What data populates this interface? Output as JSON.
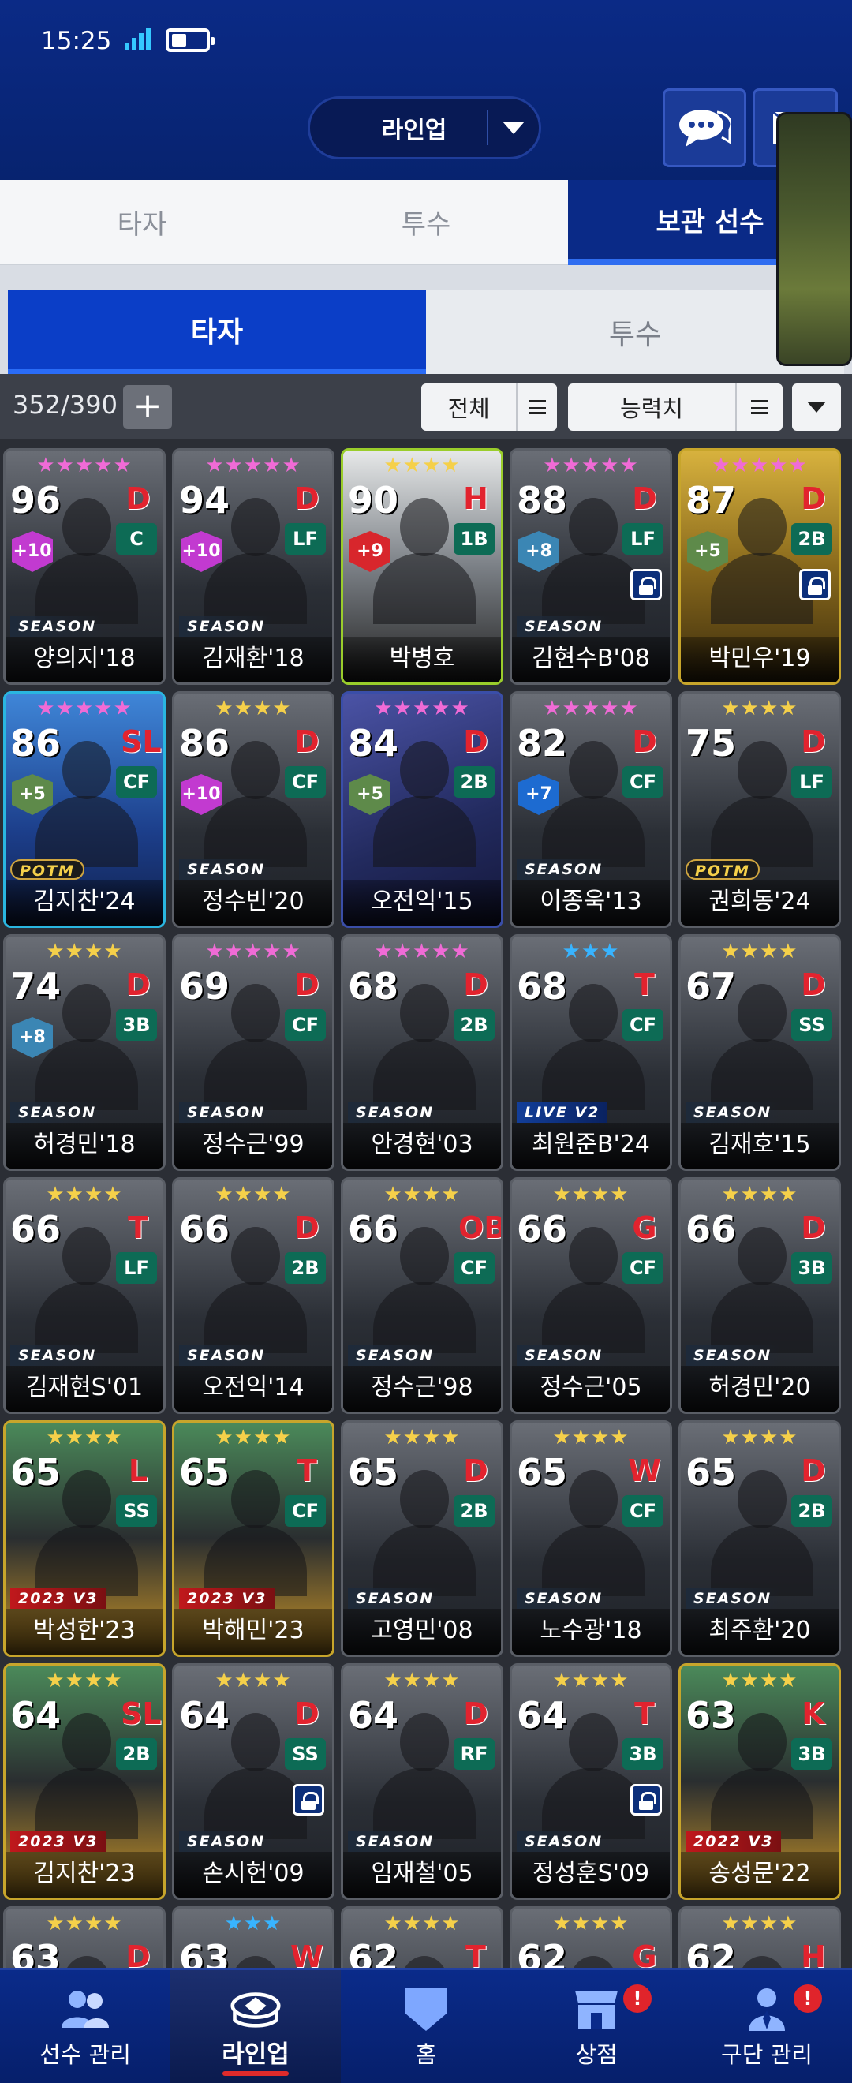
{
  "status_bar": {
    "time": "15:25"
  },
  "header": {
    "lineup_select": "라인업"
  },
  "main_tabs": [
    {
      "label": "타자",
      "active": false
    },
    {
      "label": "투수",
      "active": false
    },
    {
      "label": "보관 선수",
      "active": true
    }
  ],
  "sub_tabs": [
    {
      "label": "타자",
      "active": true
    },
    {
      "label": "투수",
      "active": false
    }
  ],
  "toolbar": {
    "count": "352/390",
    "add_label": "+",
    "filter_label": "전체",
    "sort_label": "능력치"
  },
  "cards": [
    {
      "ovr": "96",
      "stars": "★★★★★",
      "star_color": "pink",
      "team": "D",
      "pos": "C",
      "plus": "+10",
      "type": "SEASON",
      "name": "양의지'18",
      "locked": false,
      "style": ""
    },
    {
      "ovr": "94",
      "stars": "★★★★★",
      "star_color": "pink",
      "team": "D",
      "pos": "LF",
      "plus": "+10",
      "type": "SEASON",
      "name": "김재환'18",
      "locked": false,
      "style": ""
    },
    {
      "ovr": "90",
      "stars": "★★★★",
      "star_color": "gold",
      "team": "H",
      "pos": "1B",
      "plus": "+9",
      "type": "",
      "name": "박병호",
      "locked": false,
      "style": "lime"
    },
    {
      "ovr": "88",
      "stars": "★★★★★",
      "star_color": "pink",
      "team": "D",
      "pos": "LF",
      "plus": "+8",
      "type": "SEASON",
      "name": "김현수B'08",
      "locked": true,
      "style": ""
    },
    {
      "ovr": "87",
      "stars": "★★★★★",
      "star_color": "pink",
      "team": "D",
      "pos": "2B",
      "plus": "+5",
      "type": "",
      "name": "박민우'19",
      "locked": true,
      "style": "gold"
    },
    {
      "ovr": "86",
      "stars": "★★★★★",
      "star_color": "pink",
      "team": "SL",
      "pos": "CF",
      "plus": "+5",
      "type": "POTM",
      "name": "김지찬'24",
      "locked": false,
      "style": "blue"
    },
    {
      "ovr": "86",
      "stars": "★★★★",
      "star_color": "gold",
      "team": "D",
      "pos": "CF",
      "plus": "+10",
      "type": "SEASON",
      "name": "정수빈'20",
      "locked": false,
      "style": ""
    },
    {
      "ovr": "84",
      "stars": "★★★★★",
      "star_color": "pink",
      "team": "D",
      "pos": "2B",
      "plus": "+5",
      "type": "",
      "name": "오전익'15",
      "locked": false,
      "style": "navy"
    },
    {
      "ovr": "82",
      "stars": "★★★★★",
      "star_color": "pink",
      "team": "D",
      "pos": "CF",
      "plus": "+7",
      "type": "SEASON",
      "name": "이종욱'13",
      "locked": false,
      "style": ""
    },
    {
      "ovr": "75",
      "stars": "★★★★",
      "star_color": "gold",
      "team": "D",
      "pos": "LF",
      "plus": "",
      "type": "POTM",
      "name": "권희동'24",
      "locked": false,
      "style": ""
    },
    {
      "ovr": "74",
      "stars": "★★★★",
      "star_color": "gold",
      "team": "D",
      "pos": "3B",
      "plus": "+8",
      "type": "SEASON",
      "name": "허경민'18",
      "locked": false,
      "style": ""
    },
    {
      "ovr": "69",
      "stars": "★★★★★",
      "star_color": "pink",
      "team": "D",
      "pos": "CF",
      "plus": "",
      "type": "SEASON",
      "name": "정수근'99",
      "locked": false,
      "style": ""
    },
    {
      "ovr": "68",
      "stars": "★★★★★",
      "star_color": "pink",
      "team": "D",
      "pos": "2B",
      "plus": "",
      "type": "SEASON",
      "name": "안경현'03",
      "locked": false,
      "style": ""
    },
    {
      "ovr": "68",
      "stars": "★★★",
      "star_color": "blue",
      "team": "T",
      "pos": "CF",
      "plus": "",
      "type": "LIVE V2",
      "name": "최원준B'24",
      "locked": false,
      "style": ""
    },
    {
      "ovr": "67",
      "stars": "★★★★",
      "star_color": "gold",
      "team": "D",
      "pos": "SS",
      "plus": "",
      "type": "SEASON",
      "name": "김재호'15",
      "locked": false,
      "style": ""
    },
    {
      "ovr": "66",
      "stars": "★★★★",
      "star_color": "gold",
      "team": "T",
      "pos": "LF",
      "plus": "",
      "type": "SEASON",
      "name": "김재현S'01",
      "locked": false,
      "style": ""
    },
    {
      "ovr": "66",
      "stars": "★★★★",
      "star_color": "gold",
      "team": "D",
      "pos": "2B",
      "plus": "",
      "type": "SEASON",
      "name": "오전익'14",
      "locked": false,
      "style": ""
    },
    {
      "ovr": "66",
      "stars": "★★★★",
      "star_color": "gold",
      "team": "OB",
      "pos": "CF",
      "plus": "",
      "type": "SEASON",
      "name": "정수근'98",
      "locked": false,
      "style": ""
    },
    {
      "ovr": "66",
      "stars": "★★★★",
      "star_color": "gold",
      "team": "G",
      "pos": "CF",
      "plus": "",
      "type": "SEASON",
      "name": "정수근'05",
      "locked": false,
      "style": ""
    },
    {
      "ovr": "66",
      "stars": "★★★★",
      "star_color": "gold",
      "team": "D",
      "pos": "3B",
      "plus": "",
      "type": "SEASON",
      "name": "허경민'20",
      "locked": false,
      "style": ""
    },
    {
      "ovr": "65",
      "stars": "★★★★",
      "star_color": "gold",
      "team": "L",
      "pos": "SS",
      "plus": "",
      "type": "2023 V3",
      "name": "박성한'23",
      "locked": false,
      "style": "v3"
    },
    {
      "ovr": "65",
      "stars": "★★★★",
      "star_color": "gold",
      "team": "T",
      "pos": "CF",
      "plus": "",
      "type": "2023 V3",
      "name": "박해민'23",
      "locked": false,
      "style": "v3"
    },
    {
      "ovr": "65",
      "stars": "★★★★",
      "star_color": "gold",
      "team": "D",
      "pos": "2B",
      "plus": "",
      "type": "SEASON",
      "name": "고영민'08",
      "locked": false,
      "style": ""
    },
    {
      "ovr": "65",
      "stars": "★★★★",
      "star_color": "gold",
      "team": "W",
      "pos": "CF",
      "plus": "",
      "type": "SEASON",
      "name": "노수광'18",
      "locked": false,
      "style": ""
    },
    {
      "ovr": "65",
      "stars": "★★★★",
      "star_color": "gold",
      "team": "D",
      "pos": "2B",
      "plus": "",
      "type": "SEASON",
      "name": "최주환'20",
      "locked": false,
      "style": ""
    },
    {
      "ovr": "64",
      "stars": "★★★★",
      "star_color": "gold",
      "team": "SL",
      "pos": "2B",
      "plus": "",
      "type": "2023 V3",
      "name": "김지찬'23",
      "locked": false,
      "style": "v3"
    },
    {
      "ovr": "64",
      "stars": "★★★★",
      "star_color": "gold",
      "team": "D",
      "pos": "SS",
      "plus": "",
      "type": "SEASON",
      "name": "손시헌'09",
      "locked": true,
      "style": ""
    },
    {
      "ovr": "64",
      "stars": "★★★★",
      "star_color": "gold",
      "team": "D",
      "pos": "RF",
      "plus": "",
      "type": "SEASON",
      "name": "임재철'05",
      "locked": false,
      "style": ""
    },
    {
      "ovr": "64",
      "stars": "★★★★",
      "star_color": "gold",
      "team": "T",
      "pos": "3B",
      "plus": "",
      "type": "SEASON",
      "name": "정성훈S'09",
      "locked": true,
      "style": ""
    },
    {
      "ovr": "63",
      "stars": "★★★★",
      "star_color": "gold",
      "team": "K",
      "pos": "3B",
      "plus": "",
      "type": "2022 V3",
      "name": "송성문'22",
      "locked": false,
      "style": "v3"
    },
    {
      "ovr": "63",
      "stars": "★★★★",
      "star_color": "gold",
      "team": "D",
      "pos": "",
      "plus": "",
      "type": "",
      "name": "",
      "locked": false,
      "style": ""
    },
    {
      "ovr": "63",
      "stars": "★★★",
      "star_color": "blue",
      "team": "W",
      "pos": "",
      "plus": "",
      "type": "",
      "name": "",
      "locked": false,
      "style": ""
    },
    {
      "ovr": "62",
      "stars": "★★★★",
      "star_color": "gold",
      "team": "T",
      "pos": "",
      "plus": "",
      "type": "",
      "name": "",
      "locked": false,
      "style": ""
    },
    {
      "ovr": "62",
      "stars": "★★★★",
      "star_color": "gold",
      "team": "G",
      "pos": "",
      "plus": "",
      "type": "",
      "name": "",
      "locked": false,
      "style": ""
    },
    {
      "ovr": "62",
      "stars": "★★★★",
      "star_color": "gold",
      "team": "H",
      "pos": "",
      "plus": "",
      "type": "",
      "name": "",
      "locked": false,
      "style": ""
    }
  ],
  "bottom_nav": [
    {
      "label": "선수 관리",
      "icon": "players-icon",
      "active": false,
      "alert": false
    },
    {
      "label": "라인업",
      "icon": "stadium-icon",
      "active": true,
      "alert": false
    },
    {
      "label": "홈",
      "icon": "home-plate-icon",
      "active": false,
      "alert": false
    },
    {
      "label": "상점",
      "icon": "shop-icon",
      "active": false,
      "alert": true
    },
    {
      "label": "구단 관리",
      "icon": "manager-icon",
      "active": false,
      "alert": true
    }
  ],
  "alert_mark": "!",
  "colors": {
    "header_bg": "#0b2a86",
    "active_tab": "#0a2a87",
    "sub_tab_active": "#0b3ec7",
    "grid_bg": "#2b2e35",
    "alert": "#e0242b"
  }
}
